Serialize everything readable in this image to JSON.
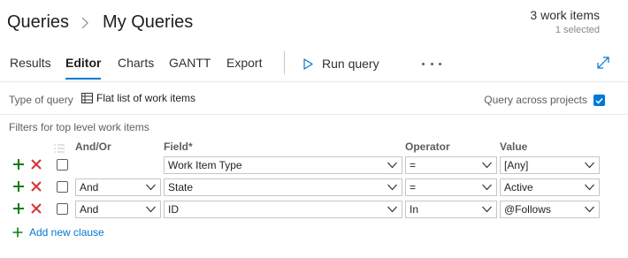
{
  "breadcrumb": {
    "root": "Queries",
    "current": "My Queries"
  },
  "work_items": {
    "count_label": "3 work items",
    "selected_label": "1 selected"
  },
  "tabs": [
    "Results",
    "Editor",
    "Charts",
    "GANTT",
    "Export"
  ],
  "active_tab": "Editor",
  "run_query_label": "Run query",
  "query_type": {
    "label": "Type of query",
    "value": "Flat list of work items"
  },
  "query_across_projects": {
    "label": "Query across projects",
    "checked": true
  },
  "filters_label": "Filters for top level work items",
  "columns": {
    "andor": "And/Or",
    "field": "Field*",
    "operator": "Operator",
    "value": "Value"
  },
  "clauses": [
    {
      "andor": "",
      "field": "Work Item Type",
      "operator": "=",
      "value": "[Any]"
    },
    {
      "andor": "And",
      "field": "State",
      "operator": "=",
      "value": "Active"
    },
    {
      "andor": "And",
      "field": "ID",
      "operator": "In",
      "value": "@Follows"
    }
  ],
  "add_clause_label": "Add new clause",
  "colors": {
    "accent": "#0078d4",
    "add": "#107c10",
    "remove": "#d13438"
  }
}
